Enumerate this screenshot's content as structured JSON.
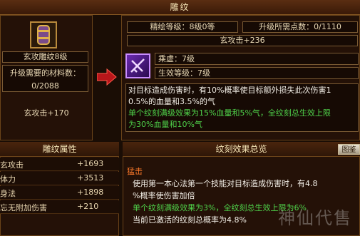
{
  "window": {
    "title": "雕纹"
  },
  "left_panel": {
    "item_name": "玄攻雕纹8级",
    "materials_title": "升级需要的材料数：",
    "materials_value": "0/2088",
    "attr_bonus": "玄攻击+170"
  },
  "right_panel": {
    "refine_level": "精绘等级：8级0等",
    "upgrade_points": "升级所需点数：0/1110",
    "attr_line": "玄攻击+236",
    "skill_name": "乘虚：7级",
    "effect_level": "生效等级：7级",
    "desc_line1": "对目标造成伤害时，有10%概率使目标额外损失此次伤害1",
    "desc_line2": "0.5%的血量和3.5%的气",
    "desc_line3": "单个纹刻满级效果为15%血量和5%气，全纹刻总生效上限",
    "desc_line4": "为30%血量和10%气"
  },
  "props_panel": {
    "title": "雕纹属性",
    "rows": [
      {
        "name": "玄攻击",
        "value": "+1693"
      },
      {
        "name": "体力",
        "value": "+3513"
      },
      {
        "name": "身法",
        "value": "+1898"
      },
      {
        "name": "忘无附加伤害",
        "value": "+210"
      }
    ]
  },
  "overview_panel": {
    "title": "纹刻效果总览",
    "button": "图鉴",
    "skill": "猛击",
    "line1": "使用第一本心法第一个技能对目标造成伤害时，有4.8",
    "line2": "%概率使伤害加倍",
    "line3": "单个纹刻满级效果为3%，全纹刻总生效上限为6%",
    "line4": "当前已激活的纹刻总概率为4.8%"
  },
  "watermark": "神仙代售"
}
